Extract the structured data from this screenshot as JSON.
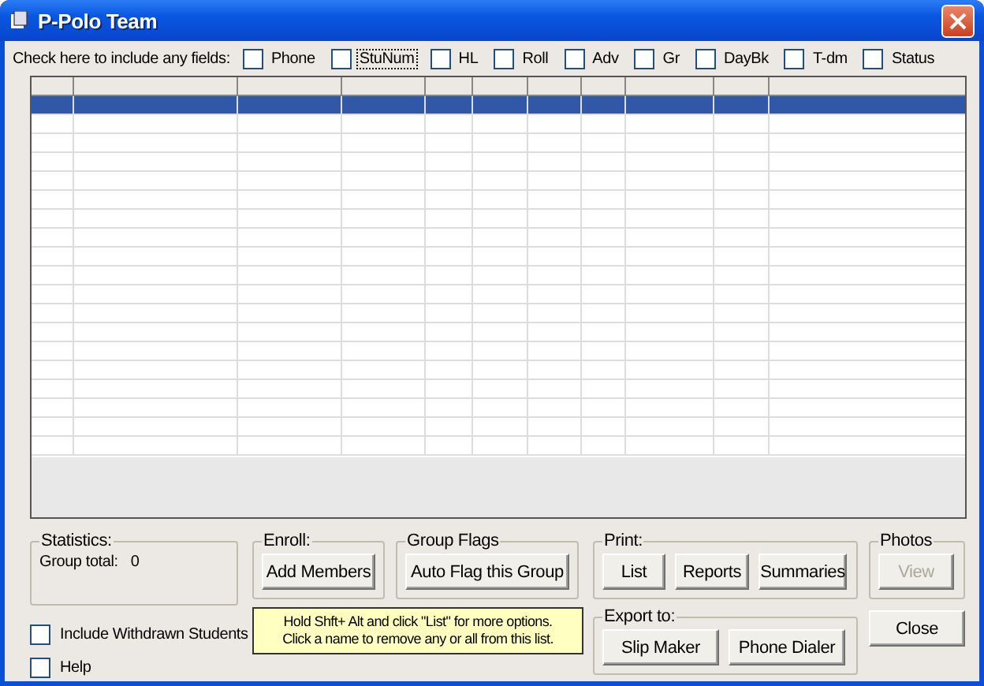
{
  "window": {
    "title": "P-Polo Team"
  },
  "fields_label": "Check here to include any fields:",
  "fields": [
    {
      "label": "Phone",
      "checked": false,
      "focused": false
    },
    {
      "label": "StuNum",
      "checked": false,
      "focused": true
    },
    {
      "label": "HL",
      "checked": false,
      "focused": false
    },
    {
      "label": "Roll",
      "checked": false,
      "focused": false
    },
    {
      "label": "Adv",
      "checked": false,
      "focused": false
    },
    {
      "label": "Gr",
      "checked": false,
      "focused": false
    },
    {
      "label": "DayBk",
      "checked": false,
      "focused": false
    },
    {
      "label": "T-dm",
      "checked": false,
      "focused": false
    },
    {
      "label": "Status",
      "checked": false,
      "focused": false
    }
  ],
  "grid": {
    "rows": [
      {
        "selected": true
      },
      {
        "selected": false
      },
      {
        "selected": false
      },
      {
        "selected": false
      },
      {
        "selected": false
      },
      {
        "selected": false
      },
      {
        "selected": false
      },
      {
        "selected": false
      },
      {
        "selected": false
      },
      {
        "selected": false
      },
      {
        "selected": false
      },
      {
        "selected": false
      },
      {
        "selected": false
      },
      {
        "selected": false
      },
      {
        "selected": false
      },
      {
        "selected": false
      },
      {
        "selected": false
      },
      {
        "selected": false
      },
      {
        "selected": false
      }
    ]
  },
  "statistics": {
    "legend": "Statistics:",
    "label": "Group total:",
    "value": "0"
  },
  "options": [
    {
      "label": "Include Withdrawn Students",
      "checked": false
    },
    {
      "label": "Help",
      "checked": false
    }
  ],
  "enroll": {
    "legend": "Enroll:",
    "buttons": [
      {
        "label": "Add Members",
        "disabled": false
      }
    ]
  },
  "group_flags": {
    "legend": "Group Flags",
    "buttons": [
      {
        "label": "Auto Flag this Group",
        "disabled": false
      }
    ]
  },
  "hint": [
    "Hold Shft+ Alt and click \"List\" for more options.",
    "Click a name to remove any or all from this list."
  ],
  "print": {
    "legend": "Print:",
    "buttons": [
      {
        "label": "List",
        "disabled": false
      },
      {
        "label": "Reports",
        "disabled": false
      },
      {
        "label": "Summaries",
        "disabled": false
      }
    ]
  },
  "export": {
    "legend": "Export to:",
    "buttons": [
      {
        "label": "Slip Maker",
        "disabled": false
      },
      {
        "label": "Phone Dialer",
        "disabled": false
      }
    ]
  },
  "photos": {
    "legend": "Photos",
    "buttons": [
      {
        "label": "View",
        "disabled": true
      }
    ]
  },
  "close_button": "Close"
}
